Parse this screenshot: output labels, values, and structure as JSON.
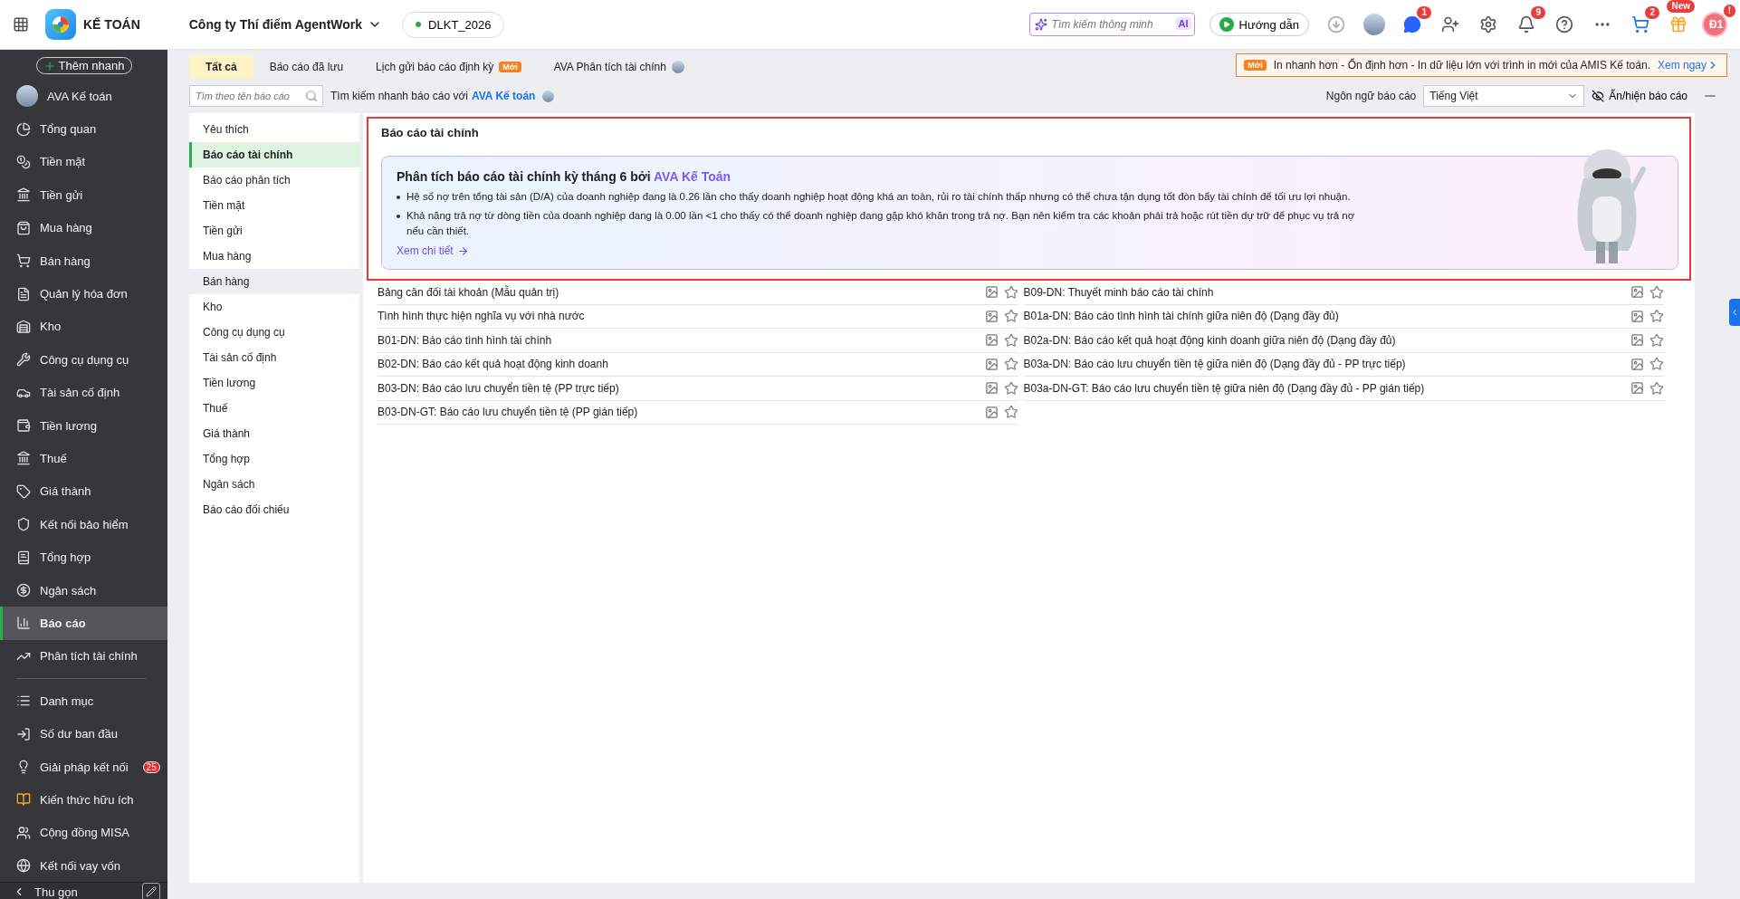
{
  "top_bar": {
    "app_name": "KẾ TOÁN",
    "company": "Công ty Thí điểm AgentWork",
    "database": "DLKT_2026",
    "search": {
      "placeholder": "Tìm kiếm thông minh",
      "badge": "AI"
    },
    "guide_button": "Hướng dẫn",
    "chat_badge": "1",
    "notification_badge": "9",
    "cart_badge": "2",
    "promo_badge": "New",
    "avatar_initials": "Đ1",
    "avatar_badge": "!"
  },
  "sidebar": {
    "quick_add": "Thêm nhanh",
    "items": [
      {
        "label": "AVA Kế toán",
        "selected": false
      },
      {
        "label": "Tổng quan",
        "selected": false
      },
      {
        "label": "Tiền mặt",
        "selected": false
      },
      {
        "label": "Tiền gửi",
        "selected": false
      },
      {
        "label": "Mua hàng",
        "selected": false
      },
      {
        "label": "Bán hàng",
        "selected": false
      },
      {
        "label": "Quản lý hóa đơn",
        "selected": false
      },
      {
        "label": "Kho",
        "selected": false
      },
      {
        "label": "Công cụ dụng cụ",
        "selected": false
      },
      {
        "label": "Tài sản cố định",
        "selected": false
      },
      {
        "label": "Tiền lương",
        "selected": false
      },
      {
        "label": "Thuế",
        "selected": false
      },
      {
        "label": "Giá thành",
        "selected": false
      },
      {
        "label": "Kết nối bảo hiểm",
        "selected": false
      },
      {
        "label": "Tổng hợp",
        "selected": false
      },
      {
        "label": "Ngân sách",
        "selected": false
      },
      {
        "label": "Báo cáo",
        "selected": true
      },
      {
        "label": "Phân tích tài chính",
        "selected": false
      }
    ],
    "secondary_items": [
      {
        "label": "Danh mục",
        "selected": false
      },
      {
        "label": "Số dư ban đầu",
        "selected": false
      },
      {
        "label": "Giải pháp kết nối",
        "selected": false,
        "badge": "25"
      },
      {
        "label": "Kiến thức hữu ích",
        "selected": false
      },
      {
        "label": "Cộng đồng MISA",
        "selected": false
      },
      {
        "label": "Kết nối vay vốn",
        "selected": false
      }
    ],
    "collapse": "Thu gọn"
  },
  "tabs": [
    {
      "label": "Tất cả",
      "selected": true
    },
    {
      "label": "Báo cáo đã lưu",
      "selected": false
    },
    {
      "label": "Lịch gửi báo cáo định kỳ",
      "selected": false,
      "badge": "Mới"
    },
    {
      "label": "AVA Phân tích tài chính",
      "selected": false
    }
  ],
  "announcement": {
    "badge": "Mới",
    "text": "In nhanh hơn - Ổn định hơn - In dữ liệu lớn với trình in mới của AMIS Kế toán.",
    "link": "Xem ngay"
  },
  "filter_bar": {
    "search": {
      "placeholder": "Tìm theo tên báo cáo"
    },
    "quick_search_label": "Tìm kiếm nhanh báo cáo với",
    "quick_search_link": "AVA Kế toán",
    "language_label": "Ngôn ngữ báo cáo",
    "language_value": "Tiếng Việt",
    "toggle_label": "Ẩn/hiện báo cáo"
  },
  "categories": [
    {
      "label": "Yêu thích",
      "selected": false,
      "hovered": false
    },
    {
      "label": "Báo cáo tài chính",
      "selected": true,
      "hovered": false
    },
    {
      "label": "Báo cáo phân tích",
      "selected": false,
      "hovered": false
    },
    {
      "label": "Tiền mặt",
      "selected": false,
      "hovered": false
    },
    {
      "label": "Tiền gửi",
      "selected": false,
      "hovered": false
    },
    {
      "label": "Mua hàng",
      "selected": false,
      "hovered": false
    },
    {
      "label": "Bán hàng",
      "selected": false,
      "hovered": true
    },
    {
      "label": "Kho",
      "selected": false,
      "hovered": false
    },
    {
      "label": "Công cụ dụng cụ",
      "selected": false,
      "hovered": false
    },
    {
      "label": "Tài sản cố định",
      "selected": false,
      "hovered": false
    },
    {
      "label": "Tiền lương",
      "selected": false,
      "hovered": false
    },
    {
      "label": "Thuế",
      "selected": false,
      "hovered": false
    },
    {
      "label": "Giá thành",
      "selected": false,
      "hovered": false
    },
    {
      "label": "Tổng hợp",
      "selected": false,
      "hovered": false
    },
    {
      "label": "Ngân sách",
      "selected": false,
      "hovered": false
    },
    {
      "label": "Báo cáo đối chiếu",
      "selected": false,
      "hovered": false
    }
  ],
  "section": {
    "title": "Báo cáo tài chính",
    "insight": {
      "title": "Phân tích báo cáo tài chính kỳ tháng 6 bởi",
      "brand": "AVA Kế Toán",
      "bullets": [
        "Hệ số nợ trên tổng tài sản (D/A) của doanh nghiệp đang là 0.26 lần cho thấy doanh nghiệp hoạt động khá an toàn, rủi ro tài chính thấp nhưng có thể chưa tận dụng tốt đòn bẩy tài chính để tối ưu lợi nhuận.",
        "Khả năng trả nợ từ dòng tiền của doanh nghiệp đang là 0.00 lần <1 cho thấy có thể doanh nghiệp đang gặp khó khăn trong trả nợ. Bạn nên kiểm tra các khoản phải trả hoặc rút tiền dự trữ để phục vụ trả nợ nếu cần thiết."
      ],
      "link": "Xem chi tiết"
    }
  },
  "reports": [
    [
      {
        "name": "Bảng cân đối tài khoản (Mẫu quản trị)",
        "favorite": false
      },
      {
        "name": "Tình hình thực hiện nghĩa vụ với nhà nước",
        "favorite": false
      },
      {
        "name": "B01-DN: Báo cáo tình hình tài chính",
        "favorite": false
      },
      {
        "name": "B02-DN: Báo cáo kết quả hoạt động kinh doanh",
        "favorite": false
      },
      {
        "name": "B03-DN: Báo cáo lưu chuyển tiền tệ (PP trực tiếp)",
        "favorite": false
      },
      {
        "name": "B03-DN-GT: Báo cáo lưu chuyển tiền tệ (PP gián tiếp)",
        "favorite": false
      }
    ],
    [
      {
        "name": "B09-DN: Thuyết minh báo cáo tài chính",
        "favorite": false
      },
      {
        "name": "B01a-DN: Báo cáo tình hình tài chính giữa niên độ (Dạng đầy đủ)",
        "favorite": false
      },
      {
        "name": "B02a-DN: Báo cáo kết quả hoạt động kinh doanh giữa niên độ (Dạng đầy đủ)",
        "favorite": false
      },
      {
        "name": "B03a-DN: Báo cáo lưu chuyển tiền tệ giữa niên độ (Dạng đầy đủ - PP trực tiếp)",
        "favorite": false
      },
      {
        "name": "B03a-DN-GT: Báo cáo lưu chuyển tiền tệ giữa niên độ (Dạng đầy đủ - PP gián tiếp)",
        "favorite": false
      }
    ]
  ]
}
